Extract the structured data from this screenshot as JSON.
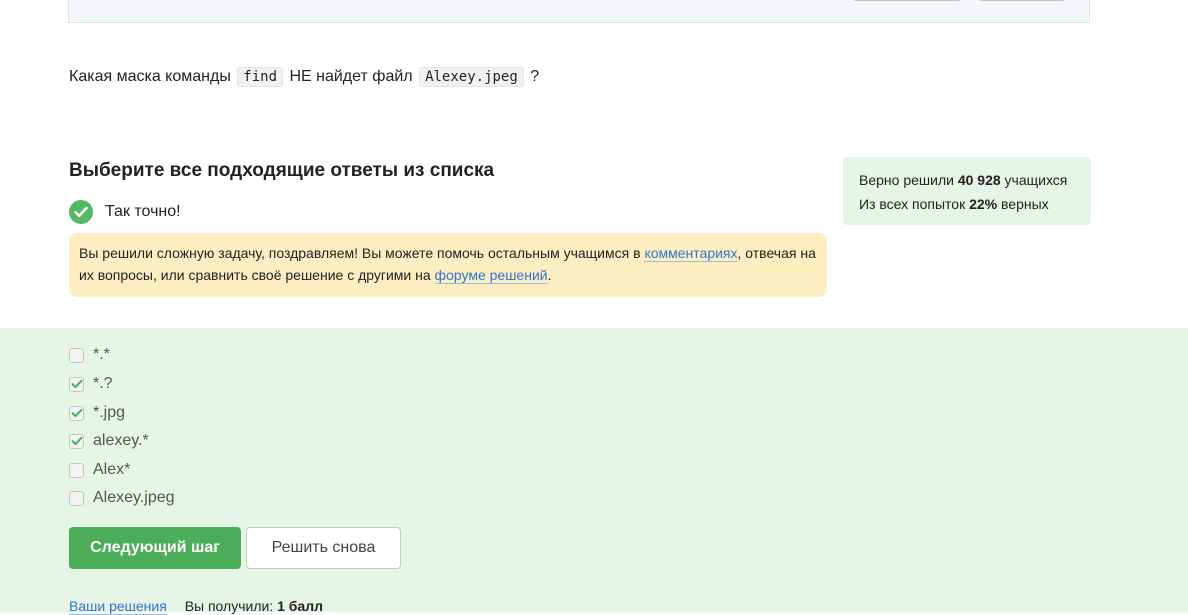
{
  "question": {
    "prefix": "Какая маска команды",
    "code1": "find",
    "middle": "НЕ найдет файл",
    "code2": "Alexey.jpeg",
    "suffix": "?"
  },
  "section_title": "Выберите все подходящие ответы из списка",
  "result": {
    "text": "Так точно!",
    "icon": "check-icon",
    "color": "#54b860"
  },
  "congrats": {
    "text1": "Вы решили сложную задачу, поздравляем! Вы можете помочь остальным учащимся в ",
    "link1": "комментариях",
    "text2": ", отвечая на их вопросы, или сравнить своё решение с другими на ",
    "link2": "форуме решений",
    "text3": "."
  },
  "stats": {
    "line1_prefix": "Верно решили",
    "line1_value": "40 928",
    "line1_suffix": "учащихся",
    "line2_prefix": "Из всех попыток",
    "line2_value": "22%",
    "line2_suffix": "верных"
  },
  "options": [
    {
      "label": "*.*",
      "checked": false
    },
    {
      "label": "*.?",
      "checked": true
    },
    {
      "label": "*.jpg",
      "checked": true
    },
    {
      "label": "alexey.*",
      "checked": true
    },
    {
      "label": "Alex*",
      "checked": false
    },
    {
      "label": "Alexey.jpeg",
      "checked": false
    }
  ],
  "buttons": {
    "next": "Следующий шаг",
    "retry": "Решить снова"
  },
  "footer": {
    "link": "Ваши решения",
    "score_prefix": "Вы получили:",
    "score_value": "1 балл"
  },
  "colors": {
    "accent": "#4cae58",
    "success_bg": "#e6f6e6",
    "notice_bg": "#fdeec2",
    "link": "#2f74d0"
  }
}
